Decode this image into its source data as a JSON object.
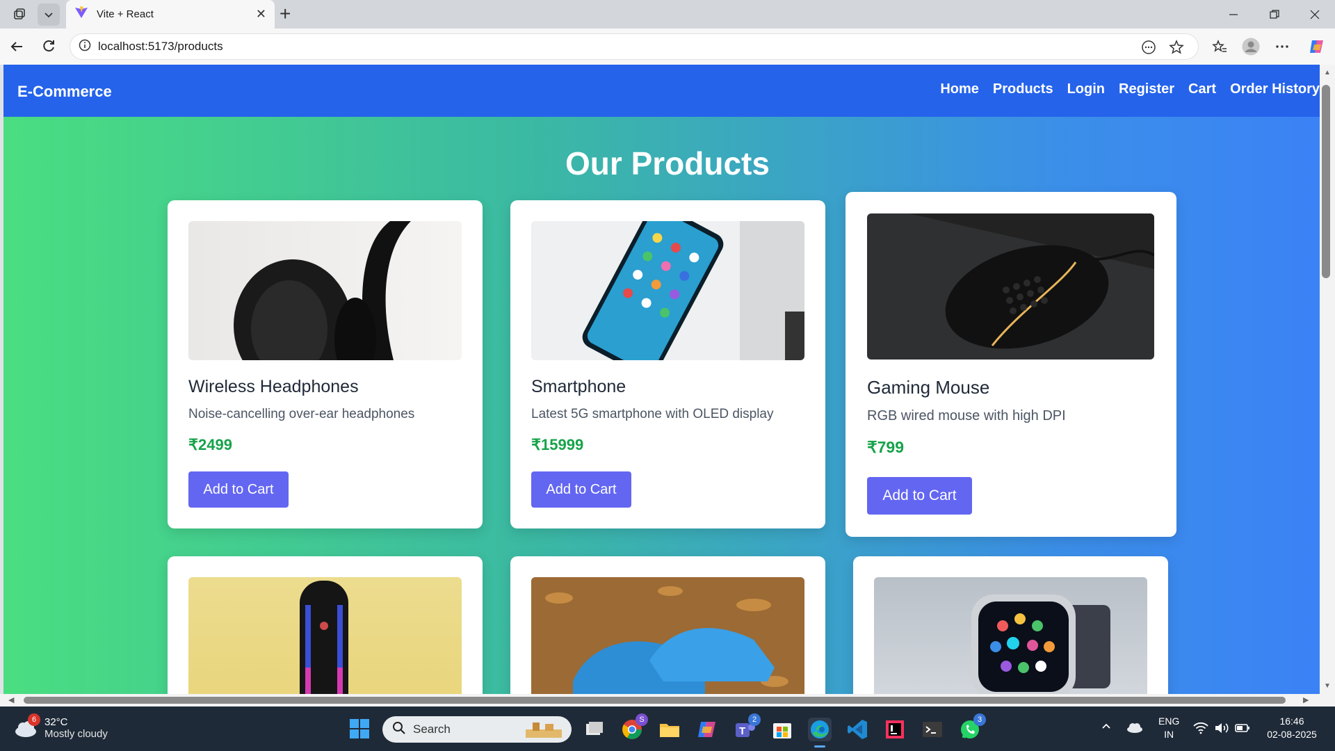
{
  "browser": {
    "tab_title": "Vite + React",
    "url": "localhost:5173/products"
  },
  "app": {
    "brand": "E-Commerce",
    "nav": [
      "Home",
      "Products",
      "Login",
      "Register",
      "Cart",
      "Order History"
    ],
    "heading": "Our Products"
  },
  "products": [
    {
      "name": "Wireless Headphones",
      "description": "Noise-cancelling over-ear headphones",
      "price": "₹2499",
      "button": "Add to Cart"
    },
    {
      "name": "Smartphone",
      "description": "Latest 5G smartphone with OLED display",
      "price": "₹15999",
      "button": "Add to Cart"
    },
    {
      "name": "Gaming Mouse",
      "description": "RGB wired mouse with high DPI",
      "price": "₹799",
      "button": "Add to Cart"
    }
  ],
  "taskbar": {
    "temperature": "32°C",
    "weather": "Mostly cloudy",
    "weather_badge": "6",
    "search_placeholder": "Search",
    "teams_badge": "2",
    "whatsapp_badge": "3",
    "lang1": "ENG",
    "lang2": "IN",
    "time": "16:46",
    "date": "02-08-2025"
  },
  "colors": {
    "nav_bg": "#2563eb",
    "gradient_start": "#4ade80",
    "gradient_end": "#3b82f6",
    "button": "#6366f1",
    "price": "#16a34a"
  }
}
